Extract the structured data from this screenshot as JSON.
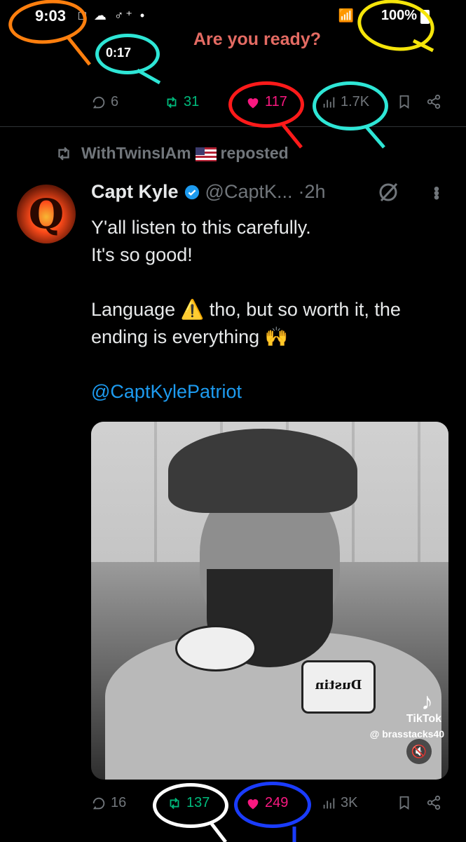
{
  "status_bar": {
    "time": "9:03",
    "icons": "□ ☁ ♂⁺ •",
    "battery": "100%"
  },
  "previous_tweet": {
    "banner_text": "Are you ready?",
    "video_timer": "0:17",
    "replies": "6",
    "reposts": "31",
    "likes": "117",
    "views": "1.7K"
  },
  "repost_header": {
    "user": "WithTwinsIAm",
    "suffix": "reposted"
  },
  "tweet": {
    "display_name": "Capt Kyle",
    "handle": "@CaptK...",
    "time": "·2h",
    "lines": [
      "Y'all listen to this carefully.",
      "It's so good!",
      "Language ⚠️ tho, but so worth it, the ending is everything 🙌"
    ],
    "mention": "@CaptKylePatriot",
    "media": {
      "patch_text": "Dustin",
      "tiktok_label": "TikTok",
      "tiktok_user": "@ brasstacks40"
    },
    "stats": {
      "replies": "16",
      "reposts": "137",
      "likes": "249",
      "views": "3K"
    }
  },
  "colors": {
    "accent_blue": "#1d9bf0",
    "like_pink": "#f91880",
    "repost_green": "#00ba7c",
    "muted_gray": "#71767b",
    "annotation_orange": "#ff7f0e",
    "annotation_cyan": "#2ee6d6",
    "annotation_yellow": "#f5e50a",
    "annotation_red": "#ff1a1a",
    "annotation_white": "#ffffff",
    "annotation_blue": "#1a3cff"
  }
}
